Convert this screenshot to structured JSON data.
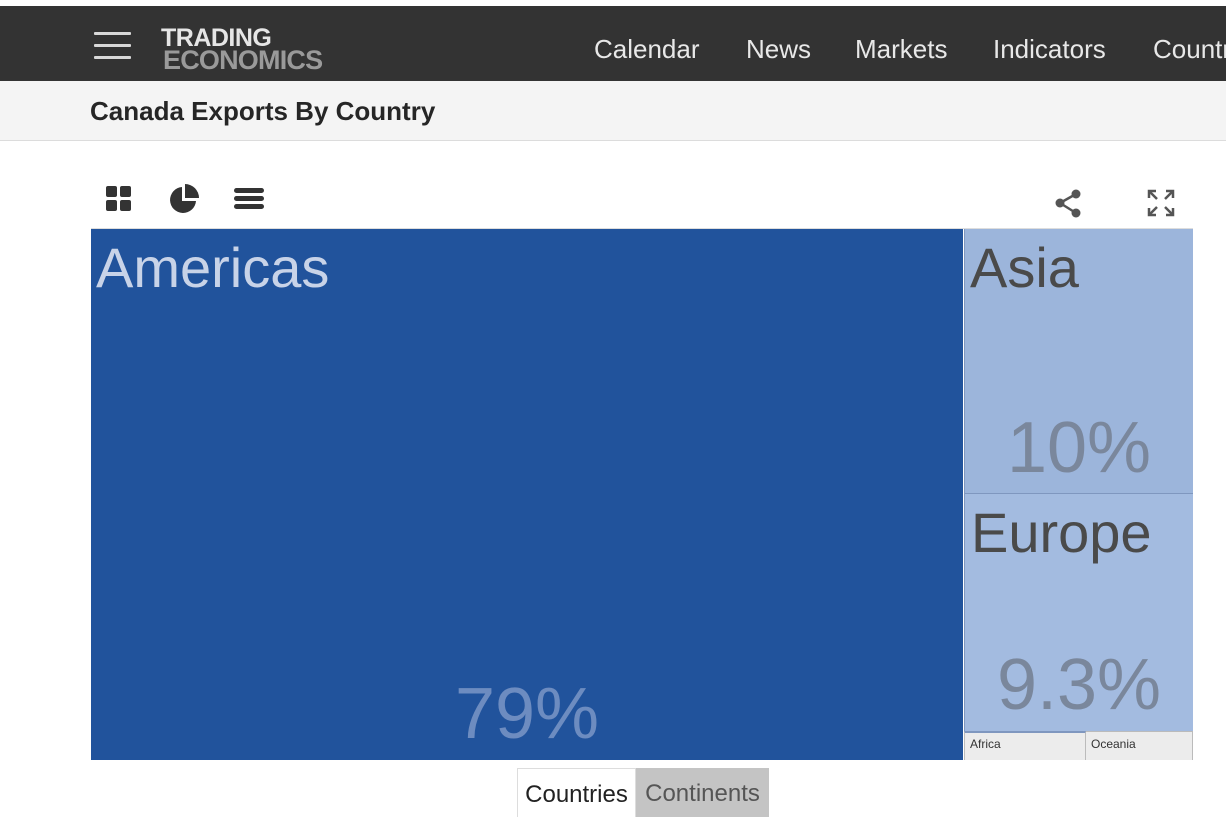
{
  "navbar": {
    "logo_top": "TRADING",
    "logo_bottom": "ECONOMICS",
    "items": [
      "Calendar",
      "News",
      "Markets",
      "Indicators",
      "Countries"
    ]
  },
  "page": {
    "title": "Canada Exports By Country"
  },
  "toolbar": {
    "icons": [
      "grid-view-icon",
      "pie-chart-icon",
      "list-view-icon",
      "share-icon",
      "fullscreen-icon"
    ]
  },
  "chart_data": {
    "type": "treemap",
    "items": [
      {
        "label": "Americas",
        "value_label": "79%",
        "value": 79,
        "color": "#21539c"
      },
      {
        "label": "Asia",
        "value_label": "10%",
        "value": 10,
        "color": "#9cb5db"
      },
      {
        "label": "Europe",
        "value_label": "9.3%",
        "value": 9.3,
        "color": "#a3bbe0"
      },
      {
        "label": "Africa",
        "value_label": "",
        "color": "#ececec"
      },
      {
        "label": "Oceania",
        "value_label": "",
        "color": "#ececec"
      }
    ]
  },
  "view_tabs": {
    "items": [
      "Countries",
      "Continents"
    ],
    "active": "Countries"
  },
  "colors": {
    "navbar_bg": "#333333",
    "titlebar_bg": "#f4f4f4",
    "americas": "#21539c",
    "asia": "#9cb5db",
    "europe": "#a3bbe0",
    "small_tiles": "#ececec",
    "inactive_tab": "#c4c4c4"
  }
}
